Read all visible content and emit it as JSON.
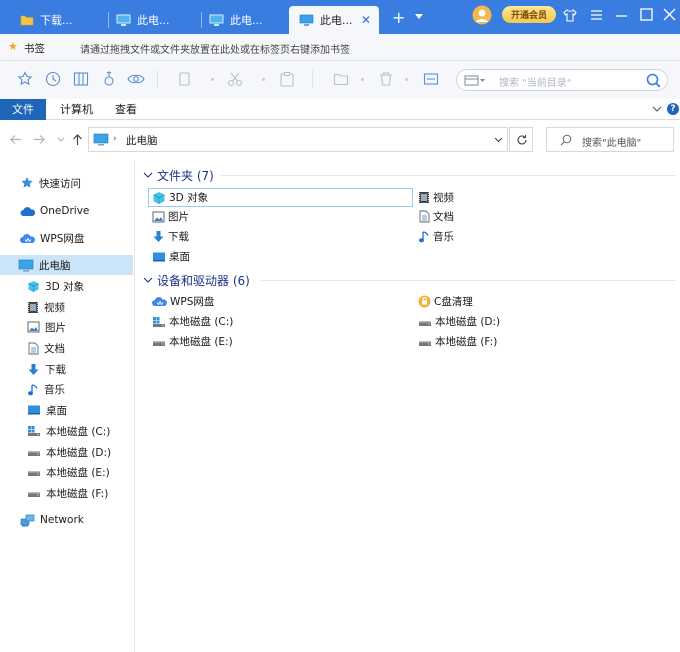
{
  "browser": {
    "tabs": [
      {
        "label": "下载..."
      },
      {
        "label": "此电..."
      },
      {
        "label": "此电..."
      },
      {
        "label": "此电..."
      }
    ],
    "vip_label": "开通会员",
    "bookmark_label": "书签",
    "bookmark_hint": "请通过拖拽文件或文件夹放置在此处或在标签页右键添加书签",
    "search_placeholder": "搜索 \"当前目录\""
  },
  "ribbon": {
    "tabs": [
      "文件",
      "计算机",
      "查看"
    ]
  },
  "address": {
    "location": "此电脑",
    "search_placeholder": "搜索\"此电脑\""
  },
  "nav": {
    "quick_access": "快速访问",
    "onedrive": "OneDrive",
    "wps_drive": "WPS网盘",
    "this_pc": "此电脑",
    "children": [
      "3D 对象",
      "视频",
      "图片",
      "文档",
      "下载",
      "音乐",
      "桌面",
      "本地磁盘 (C:)",
      "本地磁盘 (D:)",
      "本地磁盘 (E:)",
      "本地磁盘 (F:)"
    ],
    "network": "Network"
  },
  "content": {
    "folders_header": "文件夹 (7)",
    "folders": [
      "3D 对象",
      "视频",
      "图片",
      "文档",
      "下载",
      "音乐",
      "桌面"
    ],
    "devices_header": "设备和驱动器 (6)",
    "devices": [
      "WPS网盘",
      "C盘清理",
      "本地磁盘 (C:)",
      "本地磁盘 (D:)",
      "本地磁盘 (E:)",
      "本地磁盘 (F:)"
    ]
  },
  "colors": {
    "titlebar": "#3a7de0",
    "ribbon_active": "#1f66b8",
    "selection": "#cce4f7",
    "group_header": "#1e3287"
  }
}
